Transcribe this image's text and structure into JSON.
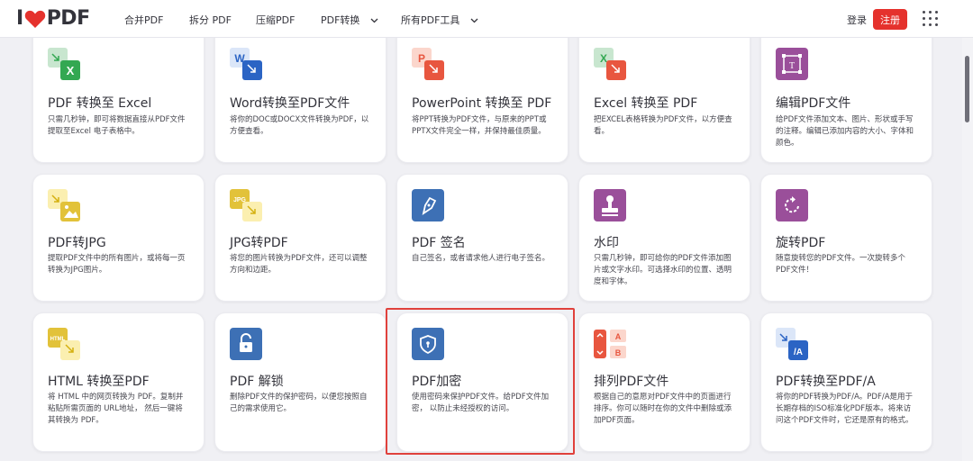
{
  "brand": {
    "logo_left": "I",
    "logo_right": "PDF"
  },
  "nav": {
    "merge": "合并PDF",
    "split": "拆分 PDF",
    "compress": "压缩PDF",
    "convert": "PDF转换",
    "all_tools": "所有PDF工具"
  },
  "account": {
    "login": "登录",
    "signup": "注册"
  },
  "tools": [
    {
      "title": "PDF 转换至 Excel",
      "desc": "只需几秒钟，即可将数据直接从PDF文件提取至Excel 电子表格中。",
      "icon": "pdf-to-excel-icon"
    },
    {
      "title": "Word转换至PDF文件",
      "desc": "将你的DOC或DOCX文件转换为PDF，以方便查看。",
      "icon": "word-to-pdf-icon"
    },
    {
      "title": "PowerPoint 转换至 PDF",
      "desc": "将PPT转换为PDF文件，与原来的PPT或PPTX文件完全一样，并保持最佳质量。",
      "icon": "powerpoint-to-pdf-icon"
    },
    {
      "title": "Excel 转换至 PDF",
      "desc": "把EXCEL表格转换为PDF文件，以方便查看。",
      "icon": "excel-to-pdf-icon"
    },
    {
      "title": "编辑PDF文件",
      "desc": "给PDF文件添加文本、图片、形状或手写的注释。编辑已添加内容的大小、字体和颜色。",
      "icon": "edit-pdf-icon"
    },
    {
      "title": "PDF转JPG",
      "desc": "提取PDF文件中的所有图片，或将每一页转换为JPG图片。",
      "icon": "pdf-to-jpg-icon"
    },
    {
      "title": "JPG转PDF",
      "desc": "将您的图片转换为PDF文件，还可以调整方向和边距。",
      "icon": "jpg-to-pdf-icon"
    },
    {
      "title": "PDF 签名",
      "desc": "自己签名，或者请求他人进行电子签名。",
      "icon": "sign-pdf-icon"
    },
    {
      "title": "水印",
      "desc": "只需几秒钟，即可给你的PDF文件添加图片或文字水印。可选择水印的位置、透明度和字体。",
      "icon": "watermark-icon"
    },
    {
      "title": "旋转PDF",
      "desc": "随意旋转您的PDF文件。一次旋转多个PDF文件！",
      "icon": "rotate-pdf-icon"
    },
    {
      "title": "HTML 转换至PDF",
      "desc": "将 HTML 中的网页转换为 PDF。复制并粘贴所需页面的 URL地址， 然后一键将其转换为 PDF。",
      "icon": "html-to-pdf-icon"
    },
    {
      "title": "PDF 解锁",
      "desc": "删除PDF文件的保护密码，以便您按照自己的需求使用它。",
      "icon": "unlock-pdf-icon"
    },
    {
      "title": "PDF加密",
      "desc": "使用密码来保护PDF文件。给PDF文件加密， 以防止未经授权的访问。",
      "icon": "protect-pdf-icon"
    },
    {
      "title": "排列PDF文件",
      "desc": "根据自己的意愿对PDF文件中的页面进行排序。你可以随时在你的文件中删除或添加PDF页面。",
      "icon": "organize-pdf-icon"
    },
    {
      "title": "PDF转换至PDF/A",
      "desc": "将你的PDF转换为PDF/A。PDF/A是用于长期存档的ISO标准化PDF版本。将来访问这个PDF文件时，它还是原有的格式。",
      "icon": "pdf-to-pdfa-icon"
    }
  ],
  "colors": {
    "brand_red": "#e5322d",
    "excel_green": "#33a852",
    "word_blue": "#2b64c4",
    "ppt_orange": "#e8563f",
    "purple": "#9a4f9a",
    "jpg_yellow": "#f7d440",
    "sign_blue": "#3d70b5"
  }
}
